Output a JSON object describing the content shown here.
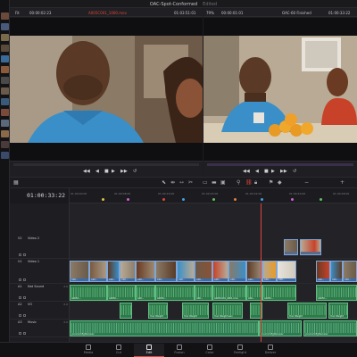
{
  "project": {
    "title": "OAC-Spot-Conformed",
    "status": "Edited"
  },
  "source_viewer": {
    "zoom": "Fit",
    "timecode_in": "00:00:02:23",
    "clip_name": "A005C001_1000.mov",
    "timecode_out": "01:03:51:01"
  },
  "timeline_viewer": {
    "zoom": "79%",
    "timecode": "00:00:01:01",
    "timeline_name": "OAC-60 Finished",
    "timecode_end": "01:00:33:22"
  },
  "timeline": {
    "current_timecode": "01:00:33:22",
    "ruler_ticks": [
      "01:00:00:00",
      "01:00:08:00",
      "01:00:16:00",
      "01:00:24:00",
      "01:00:32:00",
      "01:00:40:00",
      "01:00:48:00"
    ],
    "tracks": [
      {
        "badge": "V2",
        "name": "Video 2"
      },
      {
        "badge": "V1",
        "name": "Video 1"
      },
      {
        "badge": "A1",
        "name": "Nat Sound",
        "level": "2.0"
      },
      {
        "badge": "A2",
        "name": "VO",
        "level": "2.0"
      },
      {
        "badge": "A3",
        "name": "Music",
        "level": "2.0"
      }
    ],
    "v1_clip_label": "A00...",
    "a1_clip_label": "A00...",
    "a1_clip_label_alt": "A005C...",
    "a1_clip_label_mov": "A005C001_0901.mov",
    "vo_clip_label": "Your Weight",
    "vo_clip_label_full": "Your Weight.wav",
    "music_clip_label": "you-hurt-fighter.wav"
  },
  "pages": [
    {
      "label": "Media",
      "icon": "media-icon"
    },
    {
      "label": "Cut",
      "icon": "cut-icon"
    },
    {
      "label": "Edit",
      "icon": "edit-icon"
    },
    {
      "label": "Fusion",
      "icon": "fusion-icon"
    },
    {
      "label": "Color",
      "icon": "color-icon"
    },
    {
      "label": "Fairlight",
      "icon": "fairlight-icon"
    },
    {
      "label": "Deliver",
      "icon": "deliver-icon"
    }
  ],
  "active_page": "Edit",
  "colors": {
    "accent": "#e0443a",
    "video_clip": "#3a6aa8",
    "audio_clip": "#2e7a4a"
  }
}
